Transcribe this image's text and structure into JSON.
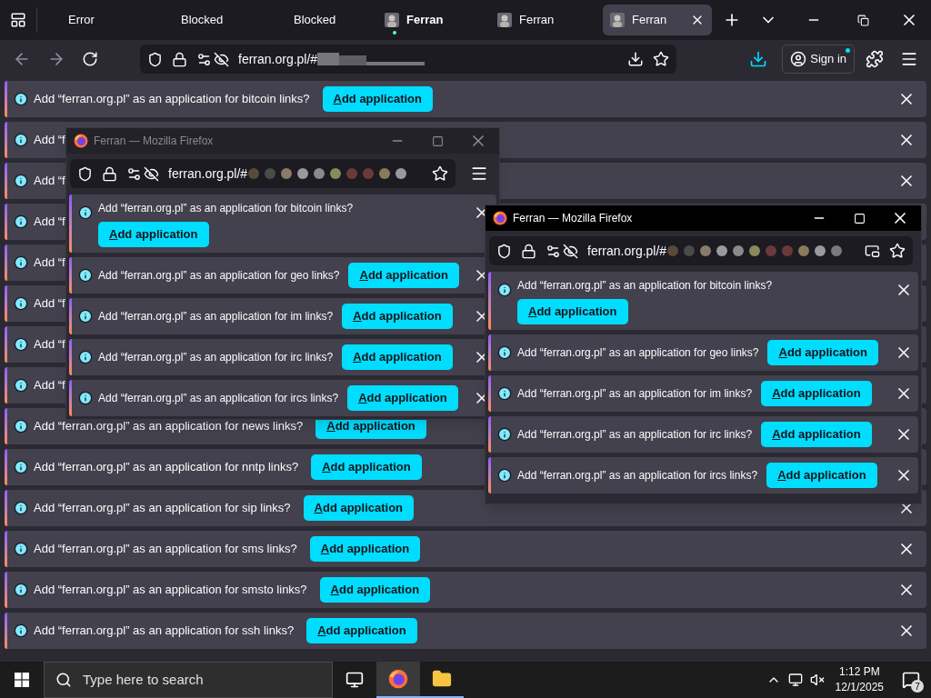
{
  "tabs": [
    {
      "label": "Error",
      "kind": "plain",
      "selected": false,
      "attention": false
    },
    {
      "label": "Blocked",
      "kind": "plain",
      "selected": false,
      "attention": false
    },
    {
      "label": "Blocked",
      "kind": "plain",
      "selected": false,
      "attention": false
    },
    {
      "label": "Ferran",
      "kind": "site",
      "selected": false,
      "attention": true
    },
    {
      "label": "Ferran",
      "kind": "site",
      "selected": false,
      "attention": false
    },
    {
      "label": "Ferran",
      "kind": "site",
      "selected": true,
      "attention": false
    }
  ],
  "toolbar": {
    "url": "ferran.org.pl/#",
    "sign_in": "Sign in"
  },
  "notifications": [
    {
      "text": "Add “ferran.org.pl” as an application for bitcoin links?",
      "button": "Add application",
      "closable": true
    },
    {
      "text": "Add “f",
      "closable": true
    },
    {
      "text": "Add “f",
      "closable": true
    },
    {
      "text": "Add “f"
    },
    {
      "text": "Add “f"
    },
    {
      "text": "Add “f"
    },
    {
      "text": "Add “f"
    },
    {
      "text": "Add “f"
    },
    {
      "text": "Add “ferran.org.pl” as an application for news links?",
      "button": "Add application"
    },
    {
      "text": "Add “ferran.org.pl” as an application for nntp links?",
      "button": "Add application"
    },
    {
      "text": "Add “ferran.org.pl” as an application for sip links?",
      "button": "Add application",
      "closable": true
    },
    {
      "text": "Add “ferran.org.pl” as an application for sms links?",
      "button": "Add application",
      "closable": true
    },
    {
      "text": "Add “ferran.org.pl” as an application for smsto links?",
      "button": "Add application",
      "closable": true
    },
    {
      "text": "Add “ferran.org.pl” as an application for ssh links?",
      "button": "Add application",
      "closable": true
    }
  ],
  "windows": [
    {
      "title": "Ferran — Mozilla Firefox",
      "active": false,
      "url": "ferran.org.pl/#",
      "notifications": [
        {
          "text": "Add “ferran.org.pl” as an application for bitcoin links?",
          "button": "Add application",
          "wrapped": true
        },
        {
          "text": "Add “ferran.org.pl” as an application for geo links?",
          "button": "Add application",
          "wrapped": false
        },
        {
          "text": "Add “ferran.org.pl” as an application for im links?",
          "button": "Add application",
          "wrapped": false
        },
        {
          "text": "Add “ferran.org.pl” as an application for irc links?",
          "button": "Add application",
          "wrapped": false
        },
        {
          "text": "Add “ferran.org.pl” as an application for ircs links?",
          "button": "Add application",
          "wrapped": false
        }
      ]
    },
    {
      "title": "Ferran — Mozilla Firefox",
      "active": true,
      "url": "ferran.org.pl/#",
      "notifications": [
        {
          "text": "Add “ferran.org.pl” as an application for bitcoin links?",
          "button": "Add application",
          "wrapped": true
        },
        {
          "text": "Add “ferran.org.pl” as an application for geo links?",
          "button": "Add application",
          "wrapped": false
        },
        {
          "text": "Add “ferran.org.pl” as an application for im links?",
          "button": "Add application",
          "wrapped": false
        },
        {
          "text": "Add “ferran.org.pl” as an application for irc links?",
          "button": "Add application",
          "wrapped": false
        },
        {
          "text": "Add “ferran.org.pl” as an application for ircs links?",
          "button": "Add application",
          "wrapped": false
        }
      ]
    }
  ],
  "taskbar": {
    "search_placeholder": "Type here to search",
    "time": "1:12 PM",
    "date": "12/1/2025",
    "notification_count": "7"
  }
}
